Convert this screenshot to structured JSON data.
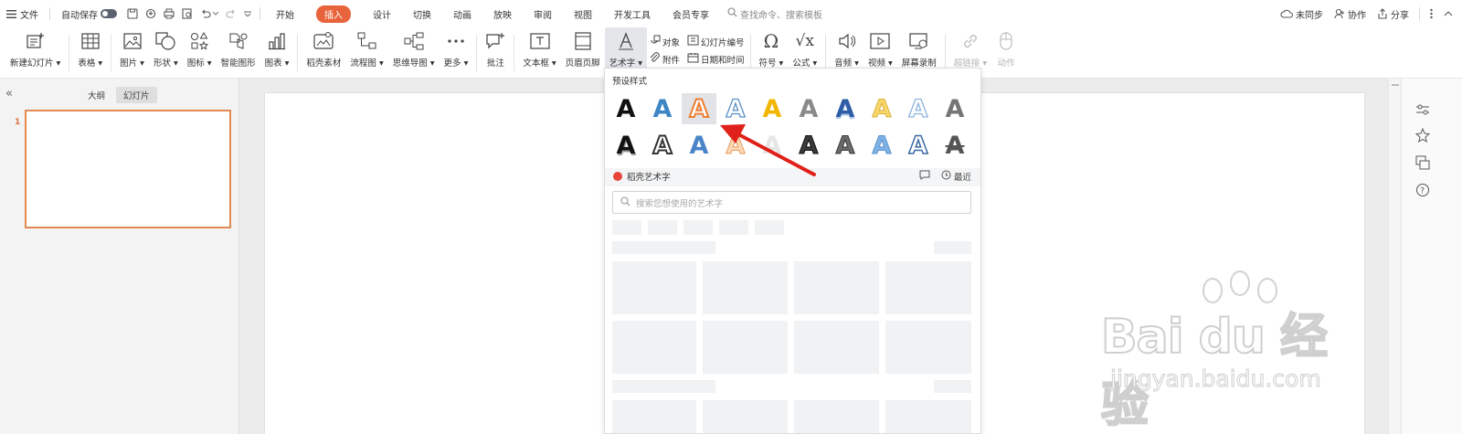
{
  "menubar": {
    "file_label": "文件",
    "autosave_label": "自动保存",
    "tabs": [
      {
        "label": "开始",
        "active": false
      },
      {
        "label": "插入",
        "active": true
      },
      {
        "label": "设计",
        "active": false
      },
      {
        "label": "切换",
        "active": false
      },
      {
        "label": "动画",
        "active": false
      },
      {
        "label": "放映",
        "active": false
      },
      {
        "label": "审阅",
        "active": false
      },
      {
        "label": "视图",
        "active": false
      },
      {
        "label": "开发工具",
        "active": false
      },
      {
        "label": "会员专享",
        "active": false
      }
    ],
    "search_placeholder": "查找命令、搜索模板",
    "sync_label": "未同步",
    "collab_label": "协作",
    "share_label": "分享"
  },
  "ribbon": {
    "new_slide": "新建幻灯片",
    "table": "表格",
    "picture": "图片",
    "shape": "形状",
    "icon": "图标",
    "smart_art": "智能图形",
    "chart": "图表",
    "docer_material": "稻壳素材",
    "flowchart": "流程图",
    "mindmap": "思维导图",
    "more": "更多",
    "comment": "批注",
    "textbox": "文本框",
    "header_footer": "页眉页脚",
    "wordart": "艺术字",
    "object": "对象",
    "slide_number": "幻灯片编号",
    "attachment": "附件",
    "date_time": "日期和时间",
    "symbol": "符号",
    "formula": "公式",
    "audio": "音频",
    "video": "视频",
    "screen_record": "屏幕录制",
    "hyperlink": "超链接",
    "action": "动作"
  },
  "leftpane": {
    "outline_tab": "大纲",
    "slides_tab": "幻灯片",
    "slide_number": "1"
  },
  "wordart_panel": {
    "preset_title": "预设样式",
    "glyph": "A",
    "docer_title": "稻壳艺术字",
    "recent_label": "最近",
    "search_placeholder": "搜索您想使用的艺术字"
  },
  "watermark": {
    "main": "Bai du 经验",
    "sub": "jingyan.baidu.com"
  },
  "colors": {
    "accent": "#e8643c",
    "slide_border": "#e28a52",
    "arrow": "#e0201a"
  }
}
